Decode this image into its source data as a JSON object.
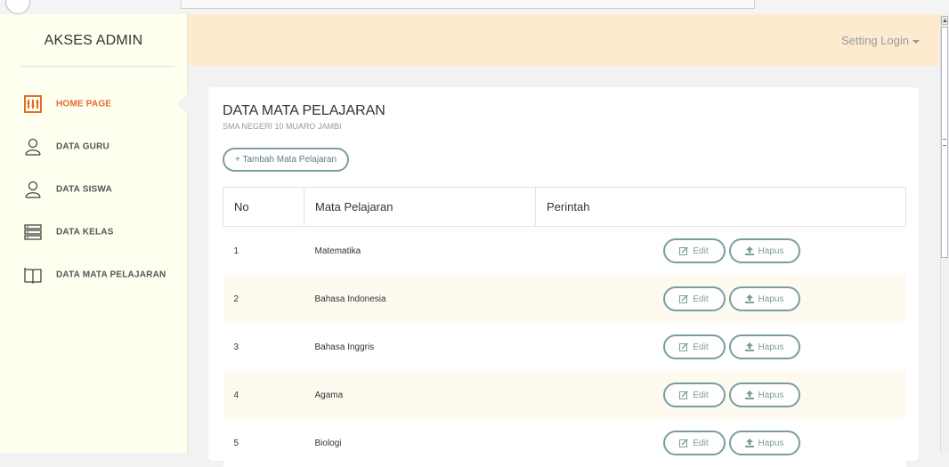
{
  "sidebar": {
    "brand": "AKSES ADMIN",
    "items": [
      {
        "label": "HOME PAGE",
        "icon": "home-dashboard-icon"
      },
      {
        "label": "DATA GURU",
        "icon": "user-icon"
      },
      {
        "label": "DATA SISWA",
        "icon": "user-icon"
      },
      {
        "label": "DATA KELAS",
        "icon": "server-list-icon"
      },
      {
        "label": "DATA MATA PELAJARAN",
        "icon": "book-icon"
      }
    ]
  },
  "header": {
    "setting_label": "Setting Login"
  },
  "card": {
    "title": "DATA MATA PELAJARAN",
    "subtitle": "SMA NEGERI 10 MUARO JAMBI",
    "add_button": "+ Tambah Mata Pelajaran"
  },
  "table": {
    "headers": [
      "No",
      "Mata Pelajaran",
      "Perintah"
    ],
    "edit_label": "Edit",
    "hapus_label": "Hapus",
    "rows": [
      {
        "no": "1",
        "name": "Matematika"
      },
      {
        "no": "2",
        "name": "Bahasa Indonesia"
      },
      {
        "no": "3",
        "name": "Bahasa Inggris"
      },
      {
        "no": "4",
        "name": "Agama"
      },
      {
        "no": "5",
        "name": "Biologi"
      }
    ]
  },
  "colors": {
    "accent": "#e36b2c",
    "header_bg": "#fdebd0",
    "sidebar_bg": "#fffff0",
    "button_border": "#7a9e9f"
  }
}
